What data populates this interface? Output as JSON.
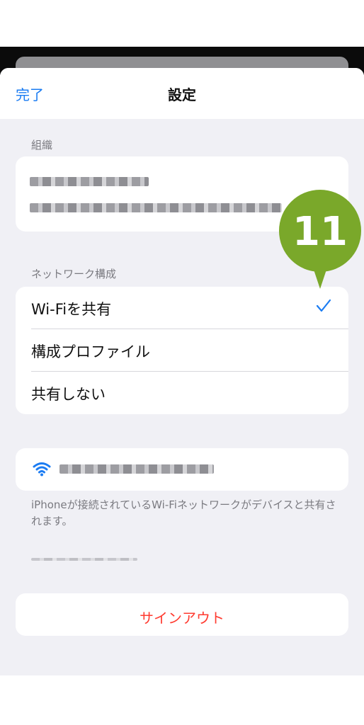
{
  "nav": {
    "done_label": "完了",
    "title": "設定"
  },
  "sections": {
    "organization_header": "組織",
    "network_header": "ネットワーク構成"
  },
  "network_options": [
    {
      "label": "Wi-Fiを共有",
      "selected": true
    },
    {
      "label": "構成プロファイル",
      "selected": false
    },
    {
      "label": "共有しない",
      "selected": false
    }
  ],
  "wifi": {
    "footnote": "iPhoneが接続されているWi-Fiネットワークがデバイスと共有されます。",
    "icon": "wifi-icon"
  },
  "signout_label": "サインアウト",
  "callout": {
    "number": "11",
    "color": "#7aa82a"
  },
  "colors": {
    "accent": "#1b7cf2",
    "destructive": "#ff3b30",
    "background": "#f0f0f5"
  }
}
